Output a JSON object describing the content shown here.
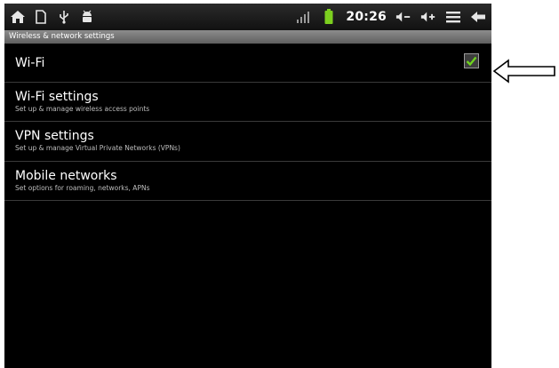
{
  "status_bar": {
    "icons_left": [
      "home-icon",
      "sd-card-icon",
      "usb-icon",
      "android-debug-icon"
    ],
    "icons_right": [
      "signal-icon",
      "battery-icon",
      "volume-down-icon",
      "volume-up-icon",
      "menu-icon",
      "back-icon"
    ],
    "clock": "20:26"
  },
  "header": {
    "title": "Wireless & network settings"
  },
  "settings": [
    {
      "title": "Wi-Fi",
      "summary": "",
      "checked": true
    },
    {
      "title": "Wi-Fi settings",
      "summary": "Set up & manage wireless access points"
    },
    {
      "title": "VPN settings",
      "summary": "Set up & manage Virtual Private Networks (VPNs)"
    },
    {
      "title": "Mobile networks",
      "summary": "Set options for roaming, networks, APNs"
    }
  ],
  "annotation": {
    "pointer_icon": "outline-arrow-left-icon"
  },
  "colors": {
    "background": "#000000",
    "title_bar": "#7a7a7a",
    "check_mark": "#6fd41e",
    "battery": "#7ccf1f"
  }
}
